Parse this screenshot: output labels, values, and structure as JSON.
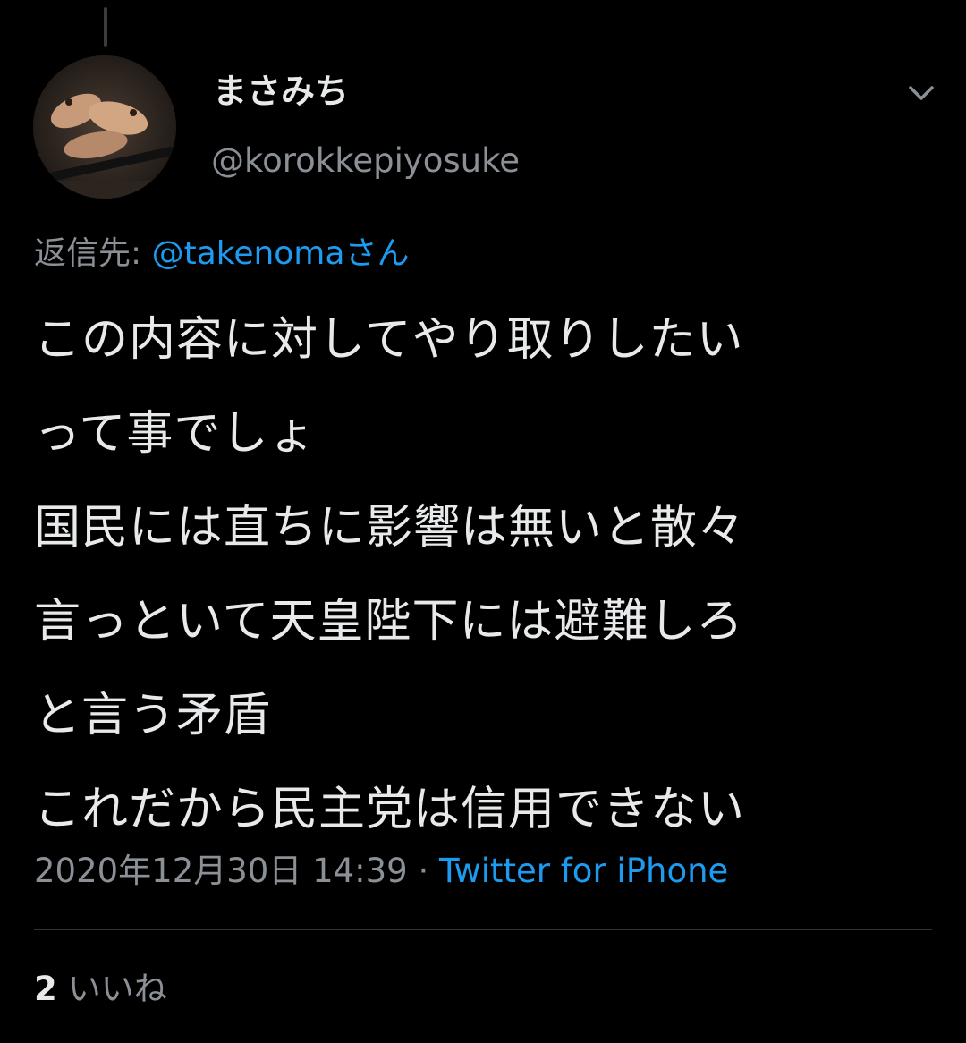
{
  "author": {
    "display_name": "まさみち",
    "handle": "@korokkepiyosuke"
  },
  "reply_to": {
    "prefix": "返信先: ",
    "mention": "@takenomaさん"
  },
  "tweet": {
    "lines": [
      "この内容に対してやり取りしたい",
      "って事でしょ",
      "国民には直ちに影響は無いと散々",
      "言っといて天皇陛下には避難しろ",
      "と言う矛盾",
      "これだから民主党は信用できない"
    ]
  },
  "meta": {
    "timestamp": "2020年12月30日 14:39",
    "separator": " · ",
    "source": "Twitter for iPhone"
  },
  "stats": {
    "likes_count": "2",
    "likes_label": "いいね"
  },
  "icons": {
    "menu": "chevron-down-icon",
    "avatar": "user-avatar"
  },
  "colors": {
    "background": "#000000",
    "link": "#1d9bf0",
    "secondary_text": "#8b9096",
    "primary_text": "#e7e9ea"
  }
}
